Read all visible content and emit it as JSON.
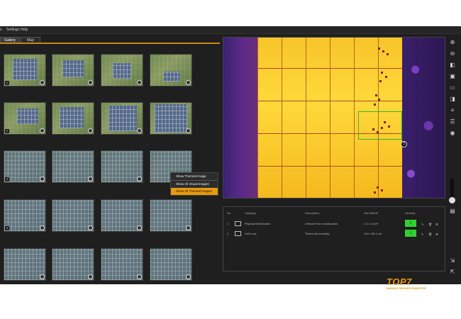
{
  "menu": {
    "items": [
      "s",
      "Settings",
      "Help"
    ]
  },
  "tabs": [
    {
      "label": "Gallery",
      "active": true
    },
    {
      "label": "Map",
      "active": false
    }
  ],
  "accent": "#e59a10",
  "context_menu": {
    "items": [
      "Show Thermal Image",
      "Show All Visual Images",
      "Show All Thermal Images"
    ],
    "selected_index": 2
  },
  "gallery": {
    "thumbnails": [
      {
        "num": "1"
      },
      {
        "num": ""
      },
      {
        "num": ""
      },
      {
        "num": ""
      },
      {
        "num": "2"
      },
      {
        "num": ""
      },
      {
        "num": ""
      },
      {
        "num": ""
      },
      {
        "num": "3"
      },
      {
        "num": ""
      },
      {
        "num": ""
      },
      {
        "num": ""
      },
      {
        "num": "4"
      },
      {
        "num": ""
      },
      {
        "num": ""
      },
      {
        "num": ""
      },
      {
        "num": ""
      },
      {
        "num": ""
      },
      {
        "num": ""
      },
      {
        "num": ""
      }
    ]
  },
  "viewer": {
    "marker_label": "2"
  },
  "findings": {
    "headers": [
      "No.",
      "Category",
      "Description",
      "Size Bitmill",
      "Severity"
    ],
    "rows": [
      {
        "no": "1",
        "category": "Physical Obstruction",
        "description": "Leftover from construction",
        "size": "1.2 x 4.4m²",
        "severity": "1"
      },
      {
        "no": "2",
        "category": "Cell Loss",
        "description": "Tinted cell anomaly",
        "size": "1x0 x 98.1 cm",
        "severity": "1"
      }
    ]
  },
  "logo": {
    "main": "TOP7",
    "sub": "MAKING DRONES SMARTER"
  },
  "toolbar_icons": [
    "zoom-in-icon",
    "zoom-out-icon",
    "image-compare-icon",
    "monitor-icon",
    "rectangle-icon",
    "panel-icon",
    "layers-icon",
    "filter-icon",
    "eye-icon",
    "palette-slider-icon",
    "export-icon"
  ]
}
